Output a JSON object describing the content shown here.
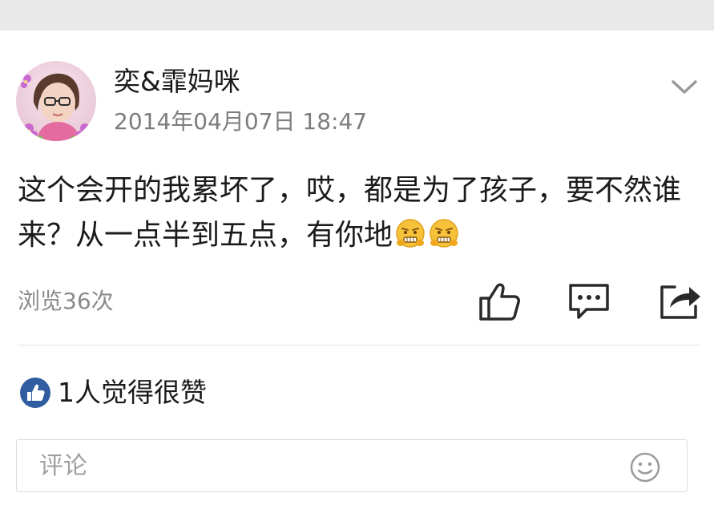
{
  "post": {
    "author": "奕&霏妈咪",
    "time": "2014年04月07日 18:47",
    "text": "这个会开的我累坏了，哎，都是为了孩子，要不然谁来？从一点半到五点，有你地",
    "emojis": [
      "grimace-emoji",
      "grimace-emoji"
    ],
    "views": "浏览36次"
  },
  "actions": {
    "icons": [
      "thumbs-up-icon",
      "comment-icon",
      "share-icon"
    ]
  },
  "likes": {
    "text": "1人觉得很赞",
    "badge_icon": "thumbs-up-badge-icon"
  },
  "comment": {
    "placeholder": "评论",
    "emoji_icon": "smiley-icon"
  },
  "colors": {
    "top_bar": "#e9e9e9",
    "text_primary": "#1b1b1b",
    "text_secondary": "#7d7d7d",
    "like_badge": "#2f5d9f",
    "emoji_yellow": "#f7c23a"
  }
}
